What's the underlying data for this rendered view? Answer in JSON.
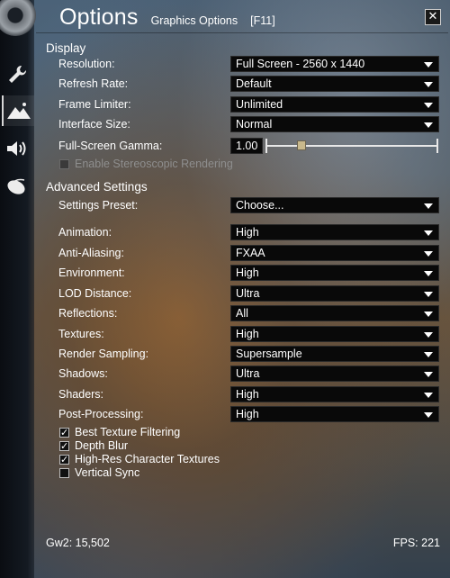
{
  "window": {
    "title": "Options",
    "subtitle": "Graphics Options",
    "hotkey": "[F11]",
    "close_icon": "close-icon"
  },
  "sidebar": {
    "tabs": [
      {
        "icon": "wrench-icon",
        "active": false
      },
      {
        "icon": "mountains-icon",
        "active": true
      },
      {
        "icon": "speaker-icon",
        "active": false
      },
      {
        "icon": "mouse-icon",
        "active": false
      }
    ]
  },
  "display": {
    "heading": "Display",
    "resolution": {
      "label": "Resolution:",
      "value": "Full Screen - 2560 x 1440"
    },
    "refresh_rate": {
      "label": "Refresh Rate:",
      "value": "Default"
    },
    "frame_limiter": {
      "label": "Frame Limiter:",
      "value": "Unlimited"
    },
    "interface_size": {
      "label": "Interface Size:",
      "value": "Normal"
    },
    "gamma": {
      "label": "Full-Screen Gamma:",
      "value": "1.00",
      "slider_level": 0.2
    },
    "stereoscopic": {
      "label": "Enable Stereoscopic Rendering",
      "checked": false,
      "disabled": true
    }
  },
  "advanced": {
    "heading": "Advanced Settings",
    "preset": {
      "label": "Settings Preset:",
      "value": "Choose..."
    },
    "settings": [
      {
        "label": "Animation:",
        "value": "High"
      },
      {
        "label": "Anti-Aliasing:",
        "value": "FXAA"
      },
      {
        "label": "Environment:",
        "value": "High"
      },
      {
        "label": "LOD Distance:",
        "value": "Ultra"
      },
      {
        "label": "Reflections:",
        "value": "All"
      },
      {
        "label": "Textures:",
        "value": "High"
      },
      {
        "label": "Render Sampling:",
        "value": "Supersample"
      },
      {
        "label": "Shadows:",
        "value": "Ultra"
      },
      {
        "label": "Shaders:",
        "value": "High"
      },
      {
        "label": "Post-Processing:",
        "value": "High"
      }
    ],
    "checkboxes": [
      {
        "label": "Best Texture Filtering",
        "checked": true
      },
      {
        "label": "Depth Blur",
        "checked": true
      },
      {
        "label": "High-Res Character Textures",
        "checked": true
      },
      {
        "label": "Vertical Sync",
        "checked": false
      }
    ]
  },
  "footer": {
    "left": "Gw2: 15,502",
    "right": "FPS: 221"
  }
}
